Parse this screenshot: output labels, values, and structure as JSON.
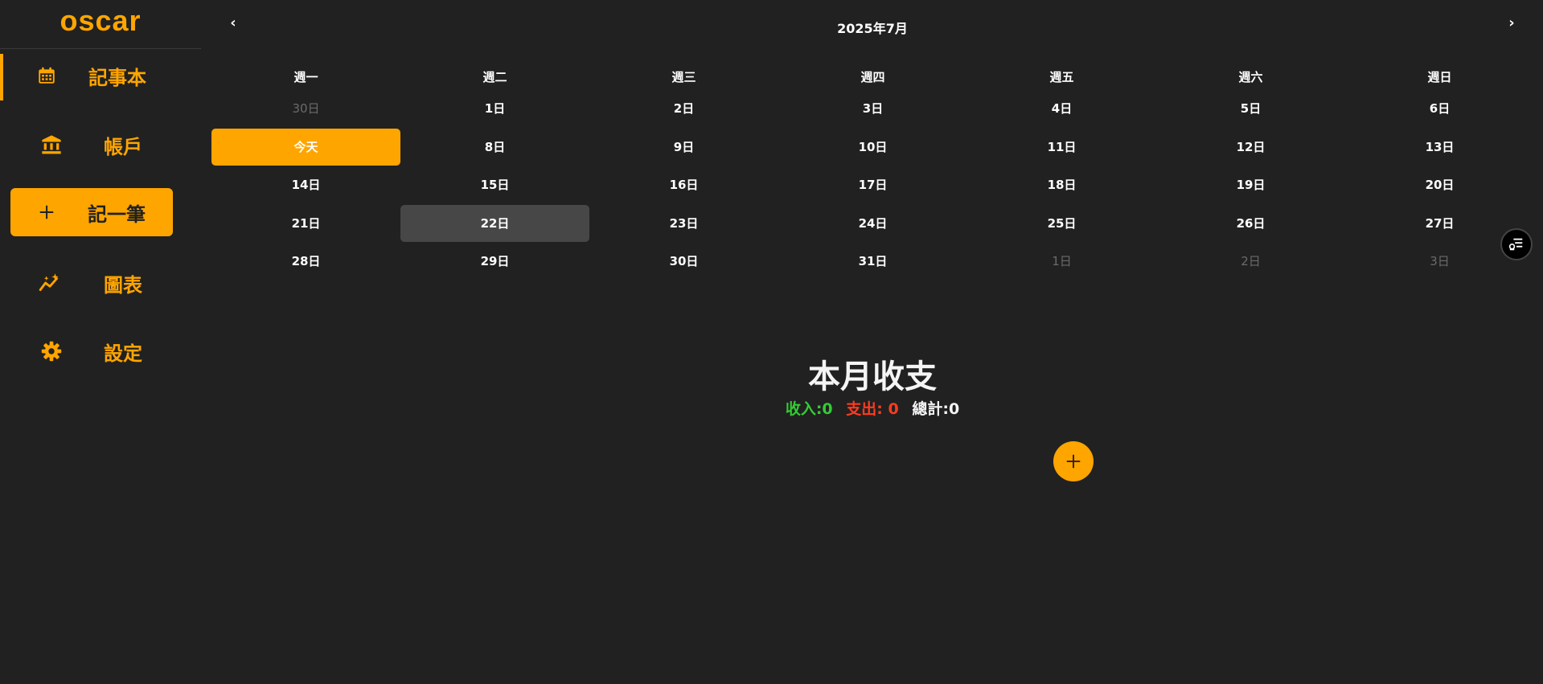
{
  "app": {
    "brand": "oscar",
    "accent_color": "#ffa500",
    "background": "#212121"
  },
  "sidebar": {
    "items": [
      {
        "label": "記事本",
        "icon": "calendar-icon",
        "active": true
      },
      {
        "label": "帳戶",
        "icon": "bank-icon"
      },
      {
        "label": "記一筆",
        "icon": "plus-icon",
        "primary": true
      },
      {
        "label": "圖表",
        "icon": "chart-sparkle-icon"
      },
      {
        "label": "設定",
        "icon": "gear-icon"
      }
    ]
  },
  "calendar": {
    "prev": "‹",
    "next": "›",
    "title": "2025年7月",
    "weekdays": [
      "週一",
      "週二",
      "週三",
      "週四",
      "週五",
      "週六",
      "週日"
    ],
    "weeks": [
      [
        {
          "label": "30日",
          "muted": true
        },
        {
          "label": "1日"
        },
        {
          "label": "2日"
        },
        {
          "label": "3日"
        },
        {
          "label": "4日"
        },
        {
          "label": "5日"
        },
        {
          "label": "6日"
        }
      ],
      [
        {
          "label": "今天",
          "today": true
        },
        {
          "label": "8日"
        },
        {
          "label": "9日"
        },
        {
          "label": "10日"
        },
        {
          "label": "11日"
        },
        {
          "label": "12日"
        },
        {
          "label": "13日"
        }
      ],
      [
        {
          "label": "14日"
        },
        {
          "label": "15日"
        },
        {
          "label": "16日"
        },
        {
          "label": "17日"
        },
        {
          "label": "18日"
        },
        {
          "label": "19日"
        },
        {
          "label": "20日"
        }
      ],
      [
        {
          "label": "21日"
        },
        {
          "label": "22日",
          "selected": true
        },
        {
          "label": "23日"
        },
        {
          "label": "24日"
        },
        {
          "label": "25日"
        },
        {
          "label": "26日"
        },
        {
          "label": "27日"
        }
      ],
      [
        {
          "label": "28日"
        },
        {
          "label": "29日"
        },
        {
          "label": "30日"
        },
        {
          "label": "31日"
        },
        {
          "label": "1日",
          "muted": true
        },
        {
          "label": "2日",
          "muted": true
        },
        {
          "label": "3日",
          "muted": true
        }
      ]
    ]
  },
  "summary": {
    "title": "本月收支",
    "income": "收入:0",
    "expense": "支出: 0",
    "total": "總計:0",
    "income_color": "#33cc33",
    "expense_color": "#ff3b1f"
  },
  "fab": {
    "icon": "plus-icon"
  },
  "filter": {
    "icon": "filter-list-icon"
  }
}
